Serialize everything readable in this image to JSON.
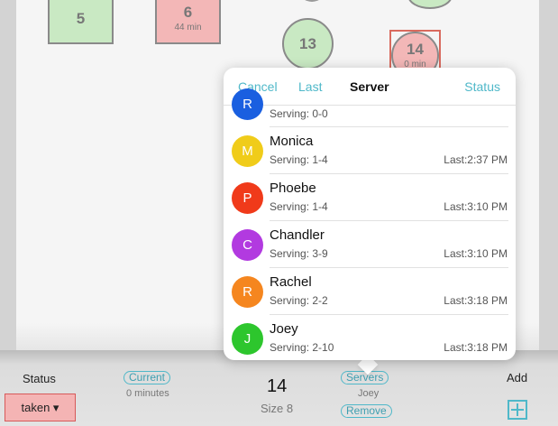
{
  "floor": {
    "tables": [
      {
        "number": "5",
        "detail": "",
        "shape": "square",
        "state": "free"
      },
      {
        "number": "6",
        "detail": "44 min",
        "shape": "square",
        "state": "taken"
      },
      {
        "number": "13",
        "detail": "",
        "shape": "circle",
        "state": "free"
      },
      {
        "number": "14",
        "detail": "0 min",
        "shape": "circle",
        "state": "taken",
        "selected": true
      }
    ]
  },
  "popover": {
    "cancel": "Cancel",
    "last": "Last",
    "title": "Server",
    "status": "Status",
    "servers": [
      {
        "initial": "R",
        "name": "",
        "serving": "Serving: 0-0",
        "last": "",
        "color": "#1a5fe0"
      },
      {
        "initial": "M",
        "name": "Monica",
        "serving": "Serving: 1-4",
        "last": "Last:2:37 PM",
        "color": "#f0cc1a"
      },
      {
        "initial": "P",
        "name": "Phoebe",
        "serving": "Serving: 1-4",
        "last": "Last:3:10 PM",
        "color": "#f03a1a"
      },
      {
        "initial": "C",
        "name": "Chandler",
        "serving": "Serving: 3-9",
        "last": "Last:3:10 PM",
        "color": "#b23ae0"
      },
      {
        "initial": "R",
        "name": "Rachel",
        "serving": "Serving: 2-2",
        "last": "Last:3:18 PM",
        "color": "#f5861f"
      },
      {
        "initial": "J",
        "name": "Joey",
        "serving": "Serving: 2-10",
        "last": "Last:3:18 PM",
        "color": "#2dc62d"
      }
    ]
  },
  "toolbar": {
    "status_label": "Status",
    "status_value": "taken ▾",
    "current_label": "Current",
    "minutes": "0 minutes",
    "table_number": "14",
    "size": "Size 8",
    "servers_label": "Servers",
    "server_name": "Joey",
    "remove_label": "Remove",
    "add_label": "Add"
  },
  "colors": {
    "accent": "#4fb8c9",
    "taken": "#f3b7b7",
    "free": "#c9e9c3"
  }
}
